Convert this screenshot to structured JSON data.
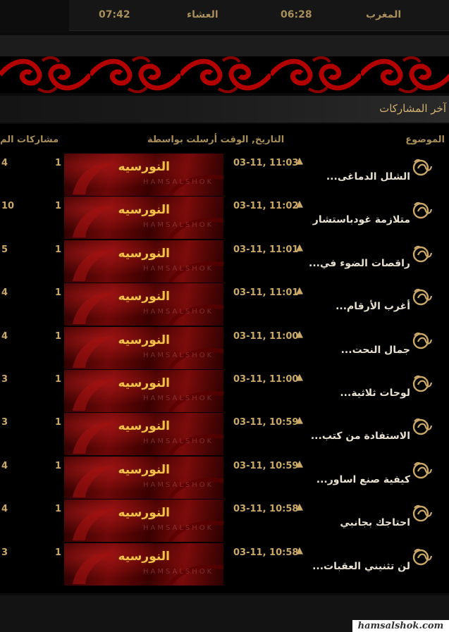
{
  "prayer_times": [
    {
      "name": "المغرب",
      "time": "06:28"
    },
    {
      "name": "العشاء",
      "time": "07:42"
    }
  ],
  "section": {
    "title": "آخر المشاركات"
  },
  "columns": {
    "topic": "الموضوع",
    "date_sender": "التاريخ, الوقت أرسلت بواسطة",
    "posts": "مشاركات الم"
  },
  "rows": [
    {
      "title": "الشلل الدماغى...",
      "date": "03-11, 11:03",
      "sender": "النورسيه",
      "replies": "1",
      "views": "4"
    },
    {
      "title": "متلازمة غودباستشار",
      "date": "03-11, 11:02",
      "sender": "النورسيه",
      "replies": "1",
      "views": "10"
    },
    {
      "title": "راقصات الضوء في...",
      "date": "03-11, 11:01",
      "sender": "النورسيه",
      "replies": "1",
      "views": "5"
    },
    {
      "title": "أغرب الأرقام...",
      "date": "03-11, 11:01",
      "sender": "النورسيه",
      "replies": "1",
      "views": "4"
    },
    {
      "title": "جمال النحت...",
      "date": "03-11, 11:00",
      "sender": "النورسيه",
      "replies": "1",
      "views": "4"
    },
    {
      "title": "لوحات ثلاثية...",
      "date": "03-11, 11:00",
      "sender": "النورسيه",
      "replies": "1",
      "views": "3"
    },
    {
      "title": "الاستفادة من كتب...",
      "date": "03-11, 10:59",
      "sender": "النورسيه",
      "replies": "1",
      "views": "3"
    },
    {
      "title": "كيفية صنع اساور...",
      "date": "03-11, 10:59",
      "sender": "النورسيه",
      "replies": "1",
      "views": "4"
    },
    {
      "title": "احتاجك بجانبي",
      "date": "03-11, 10:58",
      "sender": "النورسيه",
      "replies": "1",
      "views": "4"
    },
    {
      "title": "لن تثنيني العقبات...",
      "date": "03-11, 10:58",
      "sender": "النورسيه",
      "replies": "1",
      "views": "3"
    }
  ],
  "avatar_watermark": "HAMSALSHOK",
  "footer": {
    "brand": "hamsalshok.com"
  },
  "icons": {
    "row_icon": "calligraphy-icon",
    "arrow": "up-arrow-icon"
  },
  "colors": {
    "gold": "#d2b170",
    "banner_red": "#b00000",
    "avatar_red": "#6e0808"
  }
}
